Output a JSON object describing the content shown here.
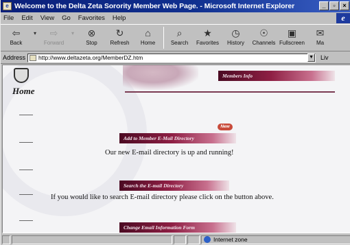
{
  "window": {
    "title": "Welcome to the Delta Zeta Sorority Member Web Page. - Microsoft Internet Explorer",
    "controls": [
      "_",
      "̲◻",
      "×"
    ]
  },
  "menu": [
    "File",
    "Edit",
    "View",
    "Go",
    "Favorites",
    "Help"
  ],
  "toolbar": [
    {
      "label": "Back",
      "glyph": "⇦",
      "enabled": true
    },
    {
      "label": "",
      "glyph": "▾",
      "enabled": true,
      "small": true
    },
    {
      "label": "Forward",
      "glyph": "⇨",
      "enabled": false
    },
    {
      "label": "",
      "glyph": "▾",
      "enabled": false,
      "small": true
    },
    {
      "label": "Stop",
      "glyph": "⊗",
      "enabled": true
    },
    {
      "label": "Refresh",
      "glyph": "↻",
      "enabled": true
    },
    {
      "label": "Home",
      "glyph": "⌂",
      "enabled": true
    },
    {
      "label": "Search",
      "glyph": "⌕",
      "enabled": true
    },
    {
      "label": "Favorites",
      "glyph": "★",
      "enabled": true
    },
    {
      "label": "History",
      "glyph": "◷",
      "enabled": true
    },
    {
      "label": "Channels",
      "glyph": "☉",
      "enabled": true
    },
    {
      "label": "Fullscreen",
      "glyph": "▣",
      "enabled": true
    },
    {
      "label": "Ma",
      "glyph": "✉",
      "enabled": true
    }
  ],
  "address": {
    "label": "Address",
    "url": "http://www.deltazeta.org/MemberDZ.htm",
    "links_label": "Liv"
  },
  "page": {
    "home_label": "Home",
    "members_info": "Members Info",
    "new_badge": "New",
    "add_directory": "Add to Member E-Mail Directory",
    "directory_text": "Our new E-mail directory is up and running!",
    "search_directory": "Search the E-mail Directory",
    "search_text": "If you would like to search E-mail directory please click on the button above.",
    "change_info": "Change Email Information Form"
  },
  "status": {
    "zone": "Internet zone"
  },
  "colors": {
    "titlebar": "#10308f",
    "banner": "#8e1f44",
    "chrome": "#c0c0c0"
  }
}
